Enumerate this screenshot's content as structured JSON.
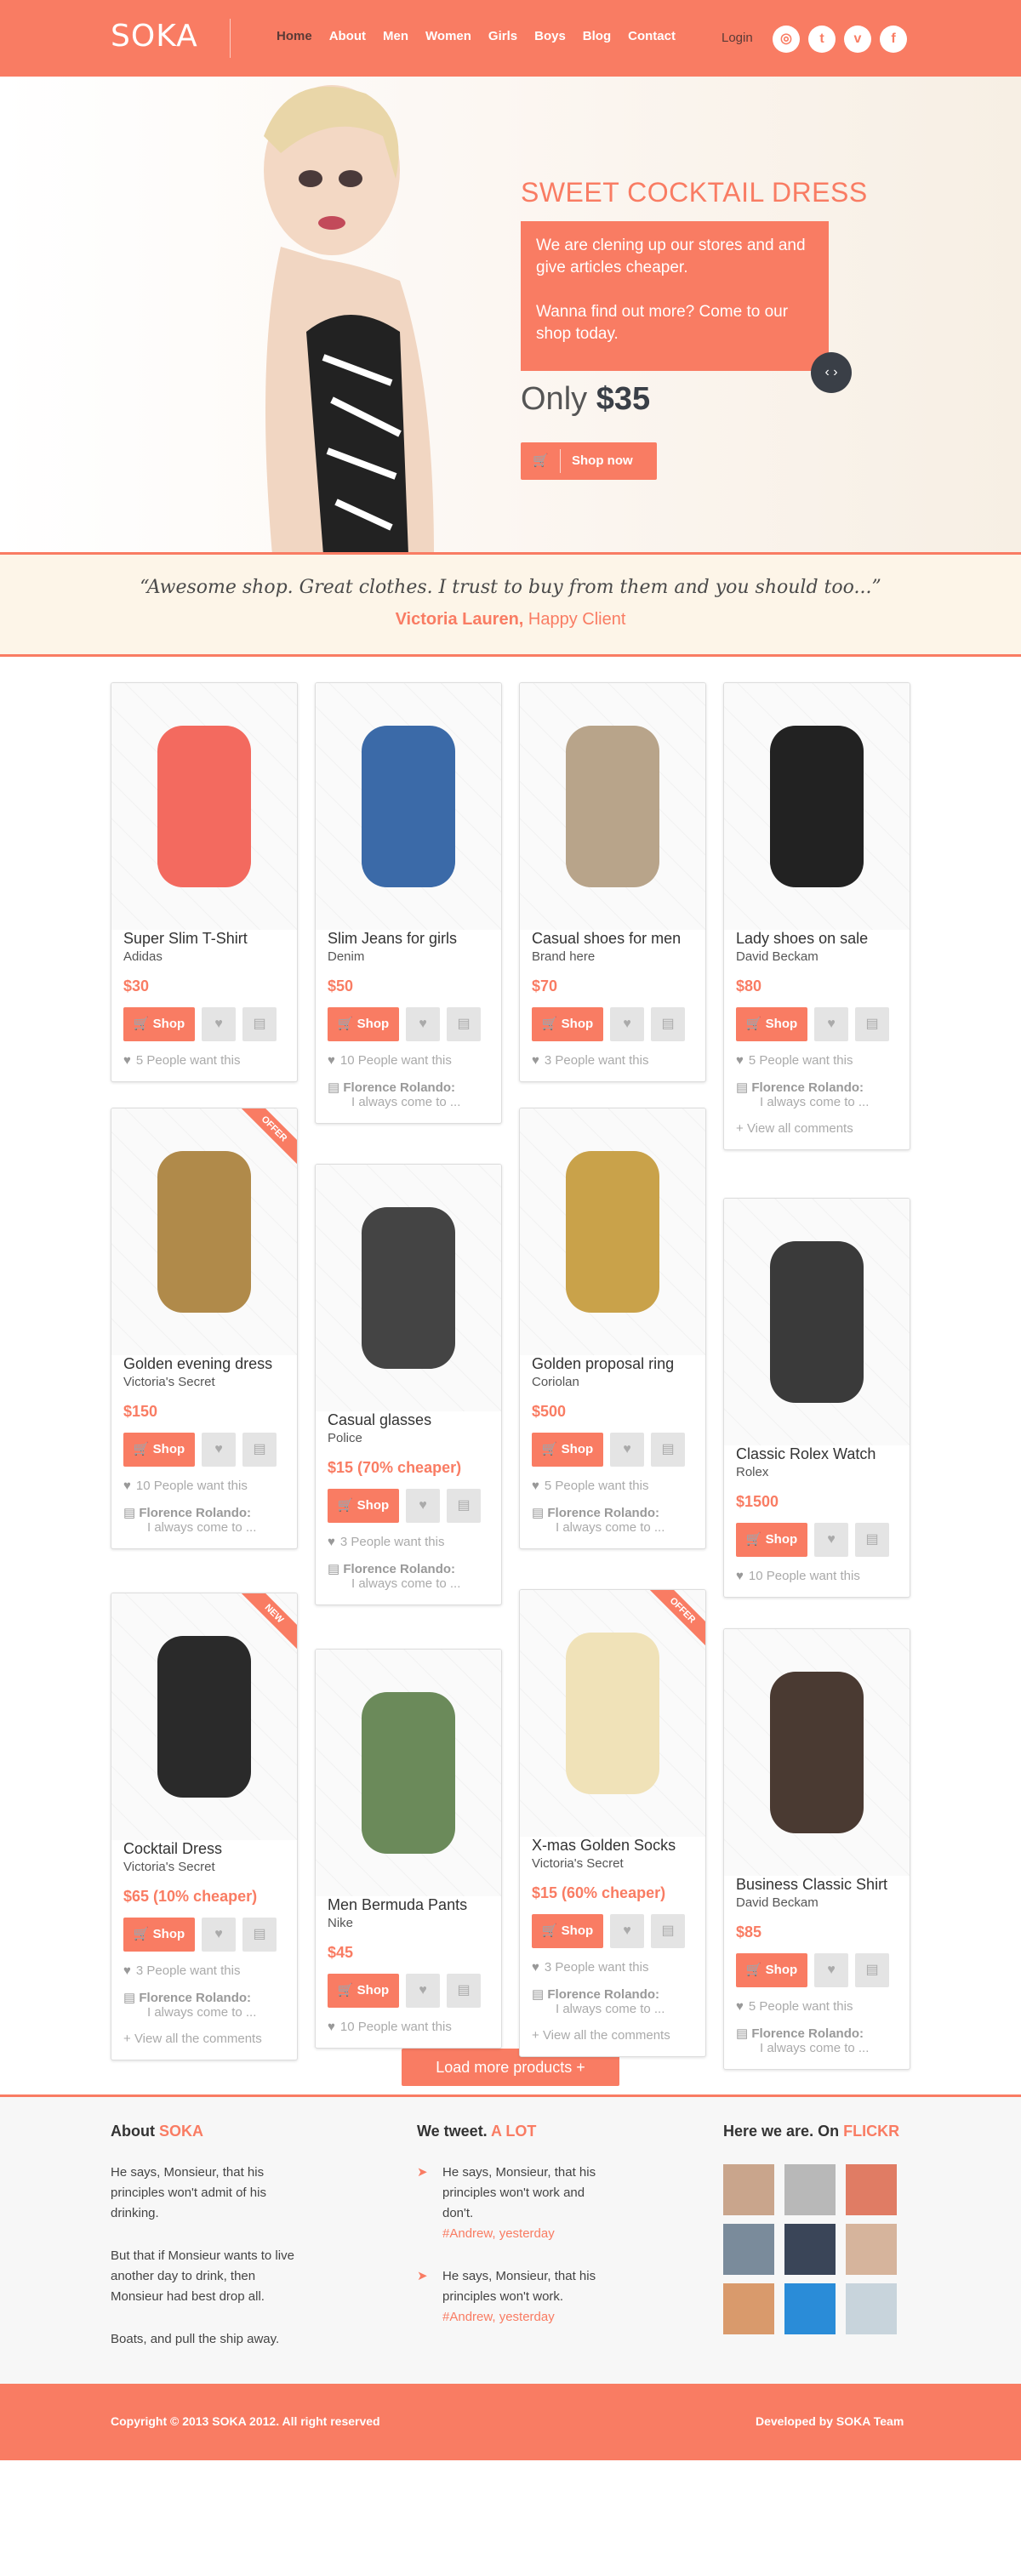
{
  "header": {
    "logo": "SOKA",
    "nav": [
      "Home",
      "About",
      "Men",
      "Women",
      "Girls",
      "Boys",
      "Blog",
      "Contact"
    ],
    "login": "Login",
    "social": [
      "dribbble-icon",
      "twitter-icon",
      "vimeo-icon",
      "facebook-icon"
    ]
  },
  "hero": {
    "title": "SWEET COCKTAIL DRESS",
    "text1": "We are clening up our stores and and give articles cheaper.",
    "text2": "Wanna find out more? Come to our shop today.",
    "price_prefix": "Only",
    "price": "$35",
    "shop_label": "Shop now"
  },
  "quote": {
    "text": "“Awesome shop. Great clothes. I trust to buy from them and you should too...”",
    "author": "Victoria Lauren,",
    "role": "Happy Client"
  },
  "products": [
    {
      "name": "Super Slim T-Shirt",
      "brand": "Adidas",
      "price": "$30",
      "want": "5 People want this"
    },
    {
      "name": "Slim Jeans for girls",
      "brand": "Denim",
      "price": "$50",
      "want": "10 People want this",
      "comment_who": "Florence Rolando:",
      "comment_txt": "I always come to ..."
    },
    {
      "name": "Casual shoes for men",
      "brand": "Brand here",
      "price": "$70",
      "want": "3 People want this"
    },
    {
      "name": "Lady shoes on sale",
      "brand": "David Beckam",
      "price": "$80",
      "want": "5 People want this",
      "comment_who": "Florence Rolando:",
      "comment_txt": "I always come to ...",
      "view": "View all comments"
    },
    {
      "name": "Golden evening dress",
      "brand": "Victoria's Secret",
      "price": "$150",
      "ribbon": "OFFER",
      "want": "10 People want this",
      "comment_who": "Florence Rolando:",
      "comment_txt": "I always come to ..."
    },
    {
      "name": "Casual glasses",
      "brand": "Police",
      "price": "$15 (70% cheaper)",
      "want": "3 People want this",
      "comment_who": "Florence Rolando:",
      "comment_txt": "I always come to ..."
    },
    {
      "name": "Golden proposal ring",
      "brand": "Coriolan",
      "price": "$500",
      "want": "5 People want this",
      "comment_who": "Florence Rolando:",
      "comment_txt": "I always come to ..."
    },
    {
      "name": "Classic Rolex Watch",
      "brand": "Rolex",
      "price": "$1500",
      "want": "10 People want this"
    },
    {
      "name": "Cocktail Dress",
      "brand": "Victoria's Secret",
      "price": "$65 (10% cheaper)",
      "ribbon": "NEW",
      "want": "3 People want this",
      "comment_who": "Florence Rolando:",
      "comment_txt": "I always come to ...",
      "view": "View all the comments"
    },
    {
      "name": "Men Bermuda Pants",
      "brand": "Nike",
      "price": "$45",
      "want": "10 People want this"
    },
    {
      "name": "X-mas Golden Socks",
      "brand": "Victoria's Secret",
      "price": "$15 (60% cheaper)",
      "ribbon": "OFFER",
      "want": "3 People want this",
      "comment_who": "Florence Rolando:",
      "comment_txt": "I always come to ...",
      "view": "View all the comments"
    },
    {
      "name": "Business Classic Shirt",
      "brand": "David Beckam",
      "price": "$85",
      "want": "5 People want this",
      "comment_who": "Florence Rolando:",
      "comment_txt": "I always come to ..."
    }
  ],
  "shop_label": "Shop",
  "load_more": "Load more products +",
  "footer": {
    "about_title": "About",
    "about_hl": "SOKA",
    "about_p1": "He says, Monsieur, that his principles won't admit of his drinking.",
    "about_p2": "But that if Monsieur wants to live another day to drink, then Monsieur had best drop all.",
    "about_p3": "Boats, and pull the ship away.",
    "tweet_title": "We tweet.",
    "tweet_hl": "A LOT",
    "tweet1": "He says, Monsieur, that his principles won't work and don't.",
    "tweet1_who": "#Andrew, yesterday",
    "tweet2": "He says, Monsieur, that his principles won't work.",
    "tweet2_who": "#Andrew, yesterday",
    "flickr_title": "Here we are. On",
    "flickr_hl": "FLICKR"
  },
  "bottom": {
    "copyright": "Copyright © 2013 SOKA 2012. All right reserved",
    "developed": "Developed by SOKA Team"
  },
  "colors": {
    "accent": "#f97c63",
    "dark": "#3a3f47"
  }
}
